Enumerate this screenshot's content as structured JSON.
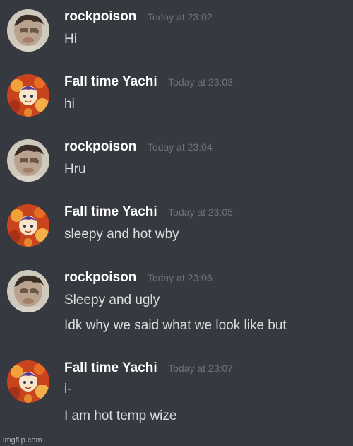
{
  "colors": {
    "background": "#36393f",
    "username": "#ffffff",
    "timestamp": "#6f737a",
    "message_text": "#dcddde"
  },
  "messages": [
    {
      "avatar": "rockpoison-avatar",
      "username": "rockpoison",
      "timestamp": "Today at 23:02",
      "lines": [
        "Hi"
      ]
    },
    {
      "avatar": "fall-time-yachi-avatar",
      "username": "Fall time Yachi",
      "timestamp": "Today at 23:03",
      "lines": [
        "hi"
      ]
    },
    {
      "avatar": "rockpoison-avatar",
      "username": "rockpoison",
      "timestamp": "Today at 23:04",
      "lines": [
        "Hru"
      ]
    },
    {
      "avatar": "fall-time-yachi-avatar",
      "username": "Fall time Yachi",
      "timestamp": "Today at 23:05",
      "lines": [
        "sleepy and hot wby"
      ]
    },
    {
      "avatar": "rockpoison-avatar",
      "username": "rockpoison",
      "timestamp": "Today at 23:06",
      "lines": [
        "Sleepy and ugly",
        "Idk why we said what we look like but"
      ]
    },
    {
      "avatar": "fall-time-yachi-avatar",
      "username": "Fall time Yachi",
      "timestamp": "Today at 23:07",
      "lines": [
        "i-",
        "I am hot temp wize"
      ]
    }
  ],
  "watermark": "imgflip.com"
}
